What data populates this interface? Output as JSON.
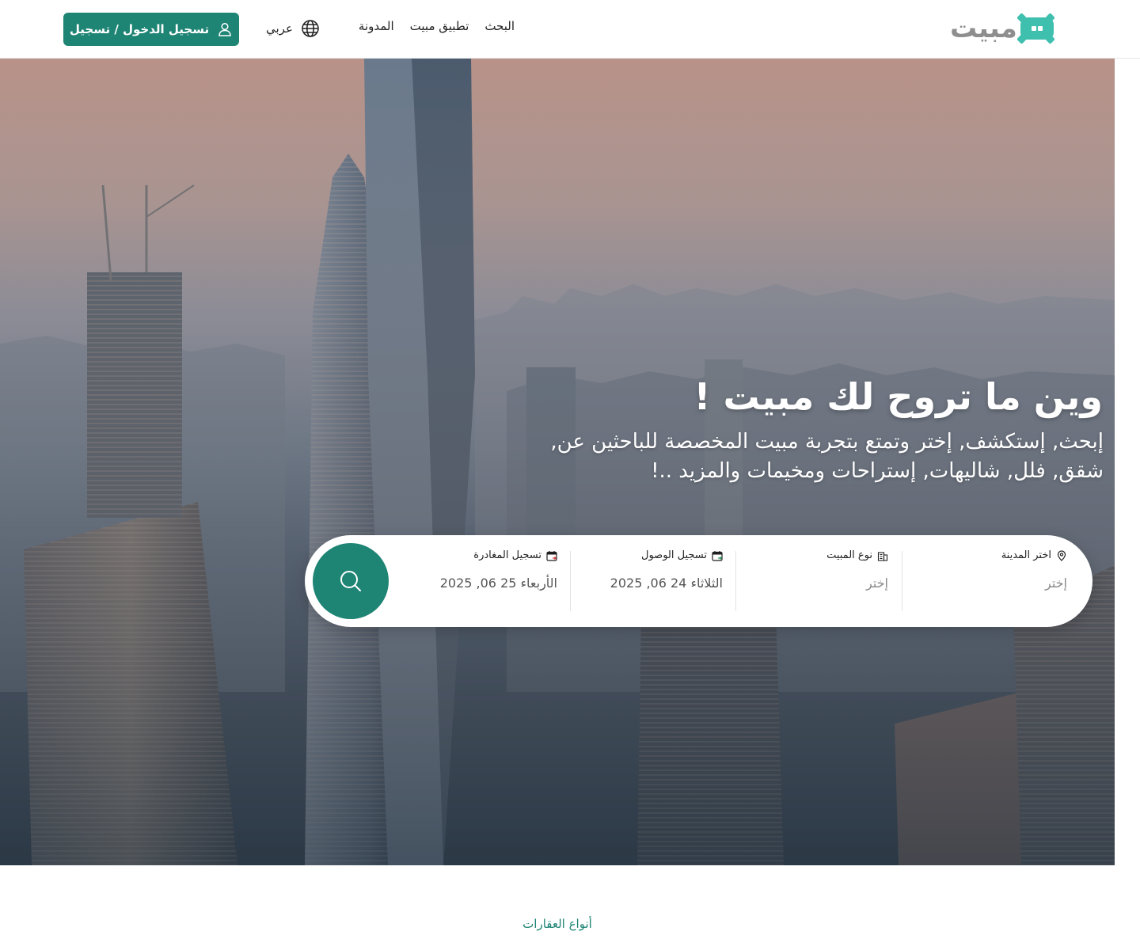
{
  "header": {
    "logo_text": "مبيت",
    "nav": [
      {
        "label": "البحث"
      },
      {
        "label": "تطبيق مبيت"
      },
      {
        "label": "المدونة"
      }
    ],
    "language_label": "عربي",
    "login_label": "تسجيل الدخول / تسجيل"
  },
  "hero": {
    "title": "وين ما تروح لك مبيت !",
    "subtitle": "إبحث, إستكشف, إختر وتمتع بتجربة مبيت المخصصة للباحثين عن, شقق, فلل, شاليهات, إستراحات ومخيمات والمزيد ..!"
  },
  "search": {
    "city": {
      "label": "اختر المدينة",
      "placeholder": "إختر"
    },
    "property_type": {
      "label": "نوع المبيت",
      "placeholder": "إختر"
    },
    "check_in": {
      "label": "تسجيل الوصول",
      "value": "الثلاثاء 24 06, 2025"
    },
    "check_out": {
      "label": "تسجيل المغادرة",
      "value": "الأربعاء 25 06, 2025"
    }
  },
  "section": {
    "tag": "أنواع العقارات"
  },
  "colors": {
    "brand": "#1e8474",
    "logo_accent": "#3fbfae",
    "logo_text": "#8e8e8e"
  }
}
